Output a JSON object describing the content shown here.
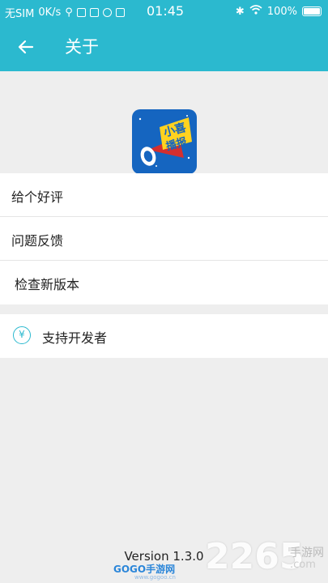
{
  "status_bar": {
    "carrier": "无SIM",
    "speed": "0K/s",
    "time": "01:45",
    "battery": "100%"
  },
  "header": {
    "title": "关于",
    "back_icon": "arrow-left-icon"
  },
  "logo": {
    "text_top": "小喜",
    "text_bottom": "播报",
    "colors": [
      "#1565c0",
      "#ffd21f",
      "#ffffff"
    ]
  },
  "menu": {
    "rate": "给个好评",
    "feedback": "问题反馈",
    "check_update": "检查新版本",
    "support": "支持开发者",
    "support_icon_glyph": "¥"
  },
  "version": "Version 1.3.0",
  "watermarks": {
    "site_2265": "2265",
    "site_2265_sub": "手游网",
    "site_2265_url": ".com",
    "gogo": "GOGO手游网",
    "gogo_url": "www.gogoo.cn"
  },
  "colors": {
    "accent": "#2bb9cf",
    "background": "#eeeeee"
  }
}
